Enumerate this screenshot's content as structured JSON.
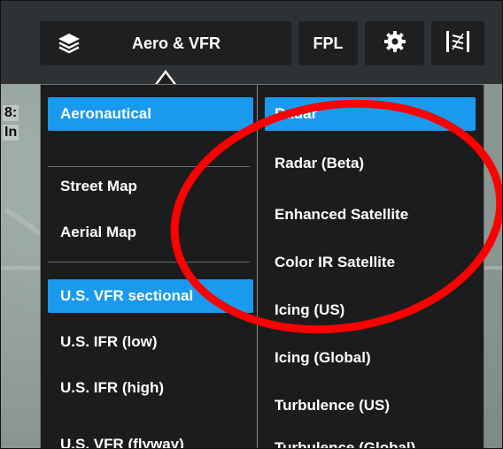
{
  "toolbar": {
    "layer_button_label": "Aero & VFR",
    "fpl_label": "FPL",
    "layers_icon": "layers-icon",
    "settings_icon": "gear-icon",
    "weather_icon": "weather-slider-icon"
  },
  "map": {
    "fragment_1": "8:",
    "fragment_2": "In"
  },
  "menu": {
    "map_types": [
      {
        "label": "Aeronautical",
        "selected": true
      },
      {
        "label": "Street Map",
        "selected": false
      },
      {
        "label": "Aerial Map",
        "selected": false
      },
      {
        "label": "U.S. VFR sectional",
        "selected": true
      },
      {
        "label": "U.S. IFR (low)",
        "selected": false
      },
      {
        "label": "U.S. IFR (high)",
        "selected": false
      },
      {
        "label": "U.S. VFR (flyway)",
        "selected": false
      }
    ],
    "weather_layers": [
      {
        "label": "Radar",
        "selected": true
      },
      {
        "label": "Radar (Beta)",
        "selected": false
      },
      {
        "label": "Enhanced Satellite",
        "selected": false
      },
      {
        "label": "Color IR Satellite",
        "selected": false
      },
      {
        "label": "Icing (US)",
        "selected": false
      },
      {
        "label": "Icing (Global)",
        "selected": false
      },
      {
        "label": "Turbulence (US)",
        "selected": false
      },
      {
        "label": "Turbulence (Global)",
        "selected": false
      }
    ]
  },
  "colors": {
    "accent": "#1a9aef",
    "panel": "#1b1c1d",
    "toolbar": "#2f3234",
    "annotation": "#ff0000"
  }
}
